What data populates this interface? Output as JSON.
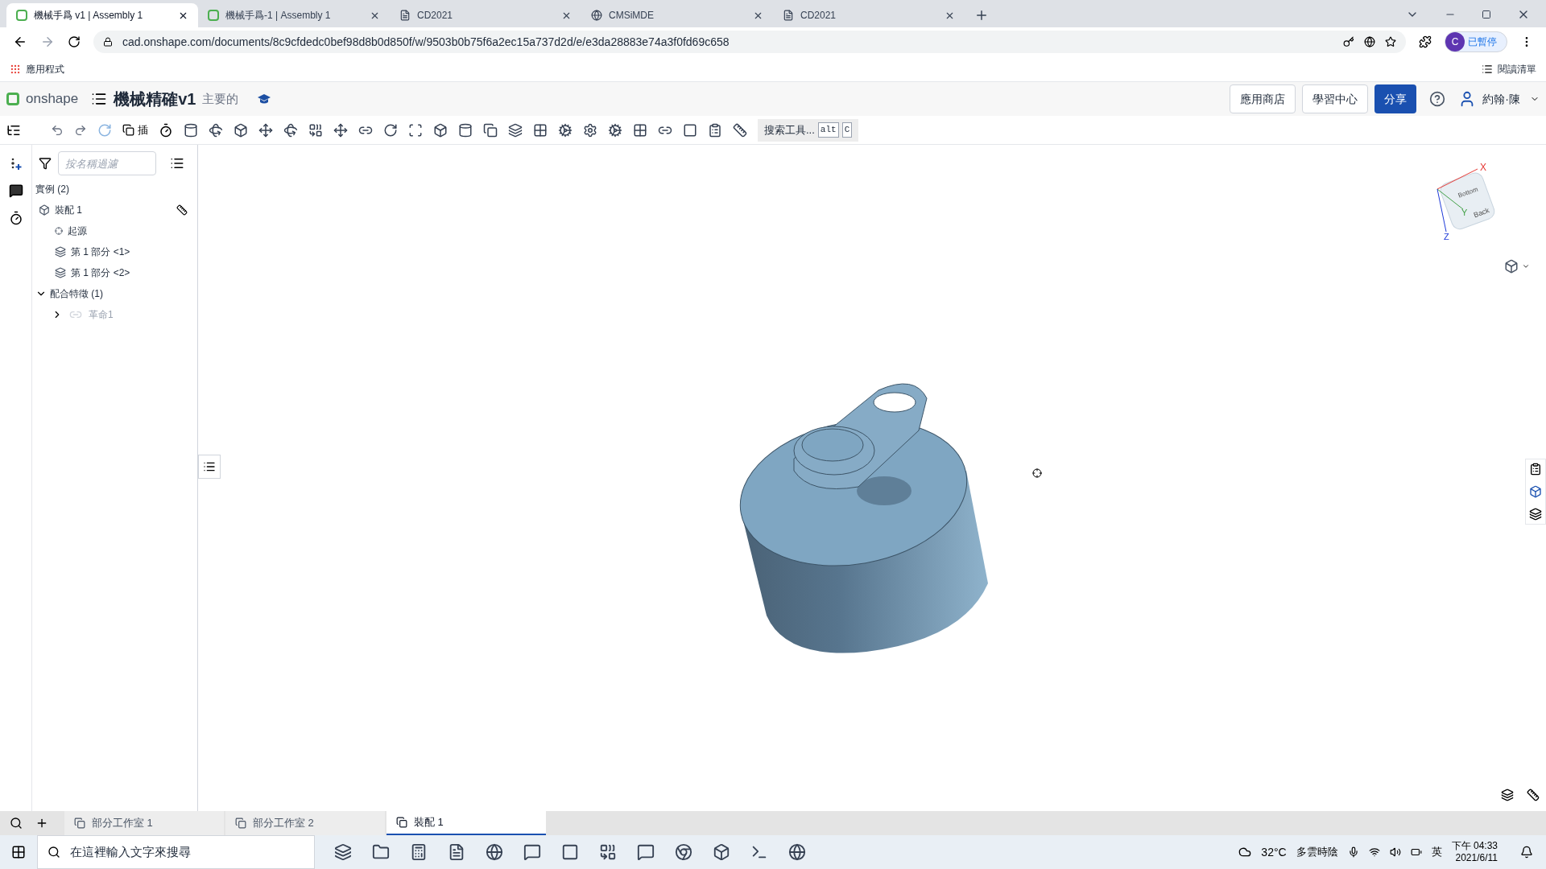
{
  "browser": {
    "tabs": [
      {
        "title": "機械手爲 v1 | Assembly 1",
        "selected": true,
        "kind": "onshape"
      },
      {
        "title": "機械手爲-1 | Assembly 1",
        "selected": false,
        "kind": "onshape"
      },
      {
        "title": "CD2021",
        "selected": false,
        "kind": "doc"
      },
      {
        "title": "CMSiMDE",
        "selected": false,
        "kind": "globe"
      },
      {
        "title": "CD2021",
        "selected": false,
        "kind": "doc"
      }
    ],
    "url": "cad.onshape.com/documents/8c9cfdedc0bef98d8b0d850f/w/9503b0b75f6a2ec15a737d2d/e/e3da28883e74a3f0fd69c658",
    "profile_initial": "C",
    "profile_status": "已暫停",
    "bookmark": "應用程式",
    "reading_list": "閱讀清單"
  },
  "header": {
    "logo": "onshape",
    "document_title": "機械精確v1",
    "branch": "主要的",
    "buttons": [
      {
        "label": "應用商店",
        "primary": false
      },
      {
        "label": "學習中心",
        "primary": false
      },
      {
        "label": "分享",
        "primary": true
      }
    ],
    "user": "約翰·陳"
  },
  "toolbar": {
    "insert_label": "插",
    "search_tools": "搜索工具...",
    "shortcut": [
      "alt",
      "C"
    ]
  },
  "panel": {
    "filter_placeholder": "按名稱過濾",
    "instances_header": "實例 (2)",
    "instances": [
      {
        "label": "裝配 1",
        "kind": "assembly",
        "children": [
          {
            "label": "起源",
            "kind": "origin"
          },
          {
            "label": "第 1 部分 <1>",
            "kind": "part"
          },
          {
            "label": "第 1 部分 <2>",
            "kind": "part"
          }
        ]
      }
    ],
    "mates": {
      "label": "配合特徵 (1)",
      "expanded": true,
      "children": [
        {
          "label": "革命1",
          "expanded": false,
          "disabled": true
        }
      ]
    }
  },
  "view_cube": {
    "axes": [
      "X",
      "Y",
      "Z"
    ],
    "faces": [
      "Bottom",
      "Back"
    ]
  },
  "bottom_tabs": [
    {
      "label": "部分工作室 1",
      "selected": false
    },
    {
      "label": "部分工作室 2",
      "selected": false
    },
    {
      "label": "裝配 1",
      "selected": true
    }
  ],
  "taskbar": {
    "search_placeholder": "在這裡輸入文字來搜尋",
    "temperature": "32°C",
    "weather": "多雲時陰",
    "ime": "英",
    "time": "下午 04:33",
    "date": "2021/6/11"
  }
}
